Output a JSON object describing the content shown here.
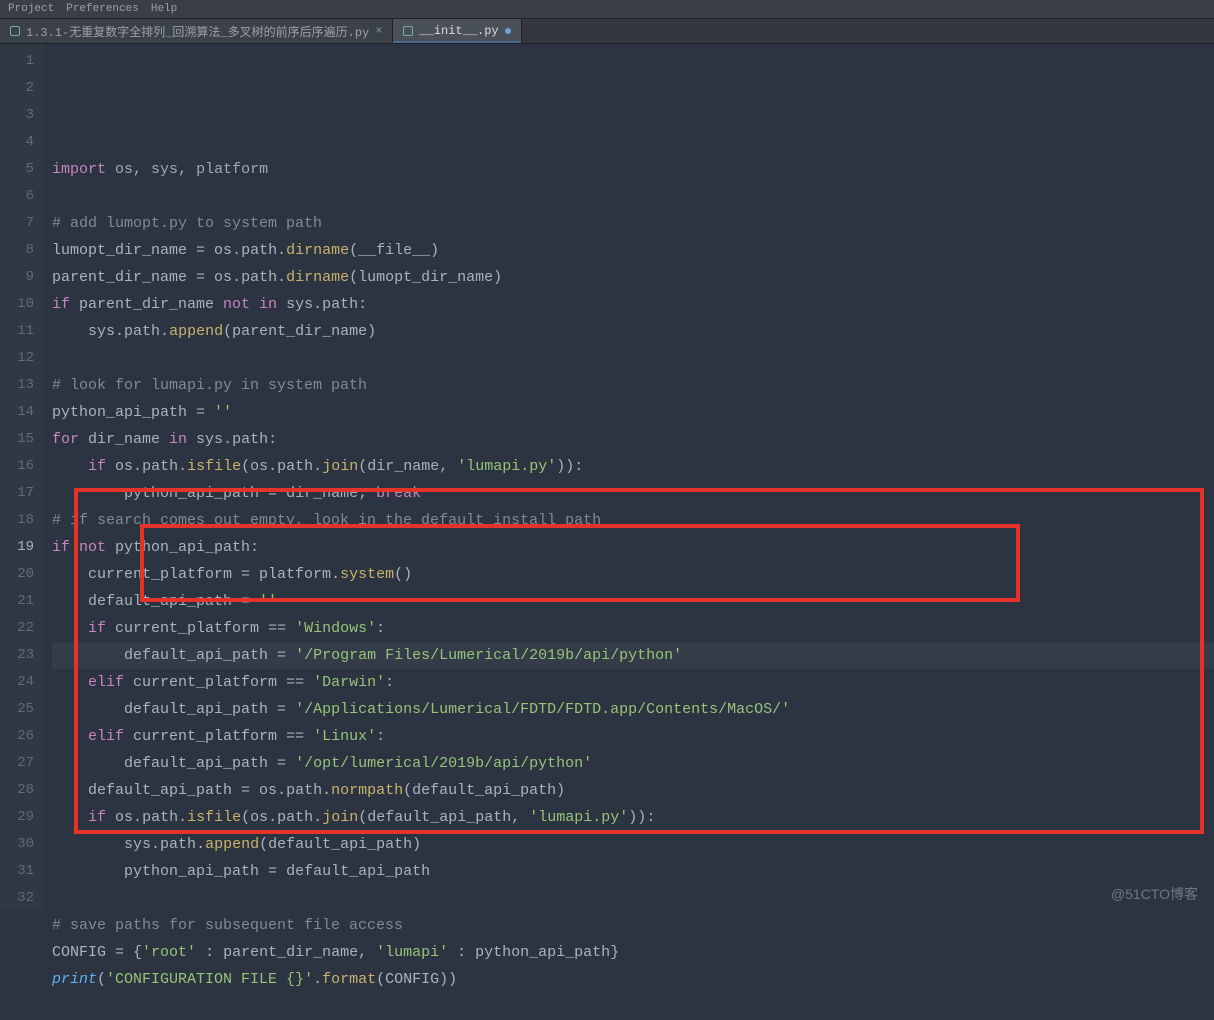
{
  "topbar": {
    "items": [
      "Project",
      "Preferences",
      "Help"
    ]
  },
  "tabs": [
    {
      "label": "1.3.1-无重复数字全排列_回溯算法_多叉树的前序后序遍历.py",
      "active": false,
      "dirty": false
    },
    {
      "label": "__init__.py",
      "active": true,
      "dirty": true
    }
  ],
  "current_line": 19,
  "lines": [
    {
      "n": 1,
      "tokens": [
        [
          "kw",
          "import"
        ],
        [
          "dn",
          " os"
        ],
        [
          "op",
          ","
        ],
        [
          "dn",
          " sys"
        ],
        [
          "op",
          ","
        ],
        [
          "dn",
          " platform"
        ]
      ]
    },
    {
      "n": 2,
      "tokens": []
    },
    {
      "n": 3,
      "tokens": [
        [
          "cmt",
          "# add lumopt.py to system path"
        ]
      ]
    },
    {
      "n": 4,
      "tokens": [
        [
          "id",
          "lumopt_dir_name "
        ],
        [
          "op",
          "="
        ],
        [
          "id",
          " os"
        ],
        [
          "op",
          "."
        ],
        [
          "id",
          "path"
        ],
        [
          "op",
          "."
        ],
        [
          "fn",
          "dirname"
        ],
        [
          "op",
          "("
        ],
        [
          "id",
          "__file__"
        ],
        [
          "op",
          ")"
        ]
      ]
    },
    {
      "n": 5,
      "tokens": [
        [
          "id",
          "parent_dir_name "
        ],
        [
          "op",
          "="
        ],
        [
          "id",
          " os"
        ],
        [
          "op",
          "."
        ],
        [
          "id",
          "path"
        ],
        [
          "op",
          "."
        ],
        [
          "fn",
          "dirname"
        ],
        [
          "op",
          "("
        ],
        [
          "id",
          "lumopt_dir_name"
        ],
        [
          "op",
          ")"
        ]
      ]
    },
    {
      "n": 6,
      "tokens": [
        [
          "kw",
          "if"
        ],
        [
          "id",
          " parent_dir_name "
        ],
        [
          "kw",
          "not in"
        ],
        [
          "id",
          " sys"
        ],
        [
          "op",
          "."
        ],
        [
          "id",
          "path"
        ],
        [
          "op",
          ":"
        ]
      ]
    },
    {
      "n": 7,
      "tokens": [
        [
          "id",
          "    sys"
        ],
        [
          "op",
          "."
        ],
        [
          "id",
          "path"
        ],
        [
          "op",
          "."
        ],
        [
          "fn",
          "append"
        ],
        [
          "op",
          "("
        ],
        [
          "id",
          "parent_dir_name"
        ],
        [
          "op",
          ")"
        ]
      ]
    },
    {
      "n": 8,
      "tokens": []
    },
    {
      "n": 9,
      "tokens": [
        [
          "cmt",
          "# look for lumapi.py in system path"
        ]
      ]
    },
    {
      "n": 10,
      "tokens": [
        [
          "id",
          "python_api_path "
        ],
        [
          "op",
          "="
        ],
        [
          "str",
          " ''"
        ]
      ]
    },
    {
      "n": 11,
      "tokens": [
        [
          "kw",
          "for"
        ],
        [
          "id",
          " dir_name "
        ],
        [
          "kw",
          "in"
        ],
        [
          "id",
          " sys"
        ],
        [
          "op",
          "."
        ],
        [
          "id",
          "path"
        ],
        [
          "op",
          ":"
        ]
      ]
    },
    {
      "n": 12,
      "tokens": [
        [
          "id",
          "    "
        ],
        [
          "kw",
          "if"
        ],
        [
          "id",
          " os"
        ],
        [
          "op",
          "."
        ],
        [
          "id",
          "path"
        ],
        [
          "op",
          "."
        ],
        [
          "fn",
          "isfile"
        ],
        [
          "op",
          "("
        ],
        [
          "id",
          "os"
        ],
        [
          "op",
          "."
        ],
        [
          "id",
          "path"
        ],
        [
          "op",
          "."
        ],
        [
          "fn",
          "join"
        ],
        [
          "op",
          "("
        ],
        [
          "id",
          "dir_name"
        ],
        [
          "op",
          ","
        ],
        [
          "str",
          " 'lumapi.py'"
        ],
        [
          "op",
          "))"
        ],
        [
          "op",
          ":"
        ]
      ]
    },
    {
      "n": 13,
      "tokens": [
        [
          "id",
          "        python_api_path "
        ],
        [
          "op",
          "="
        ],
        [
          "id",
          " dir_name"
        ],
        [
          "op",
          "; "
        ],
        [
          "kw",
          "break"
        ]
      ]
    },
    {
      "n": 14,
      "tokens": [
        [
          "cmt",
          "# if search comes out empty, look in the default install path"
        ]
      ]
    },
    {
      "n": 15,
      "tokens": [
        [
          "kw",
          "if not"
        ],
        [
          "id",
          " python_api_path"
        ],
        [
          "op",
          ":"
        ]
      ]
    },
    {
      "n": 16,
      "tokens": [
        [
          "id",
          "    current_platform "
        ],
        [
          "op",
          "="
        ],
        [
          "id",
          " platform"
        ],
        [
          "op",
          "."
        ],
        [
          "fn",
          "system"
        ],
        [
          "op",
          "()"
        ]
      ]
    },
    {
      "n": 17,
      "tokens": [
        [
          "id",
          "    default_api_path "
        ],
        [
          "op",
          "="
        ],
        [
          "str",
          " ''"
        ]
      ]
    },
    {
      "n": 18,
      "tokens": [
        [
          "id",
          "    "
        ],
        [
          "kw",
          "if"
        ],
        [
          "id",
          " current_platform "
        ],
        [
          "op",
          "=="
        ],
        [
          "str",
          " 'Windows'"
        ],
        [
          "op",
          ":"
        ]
      ]
    },
    {
      "n": 19,
      "tokens": [
        [
          "id",
          "        default_api_path "
        ],
        [
          "op",
          "="
        ],
        [
          "str",
          " '/Program Files/Lumerical/2019b/api/python'"
        ]
      ]
    },
    {
      "n": 20,
      "tokens": [
        [
          "id",
          "    "
        ],
        [
          "kw",
          "elif"
        ],
        [
          "id",
          " current_platform "
        ],
        [
          "op",
          "=="
        ],
        [
          "str",
          " 'Darwin'"
        ],
        [
          "op",
          ":"
        ]
      ]
    },
    {
      "n": 21,
      "tokens": [
        [
          "id",
          "        default_api_path "
        ],
        [
          "op",
          "="
        ],
        [
          "str",
          " '/Applications/Lumerical/FDTD/FDTD.app/Contents/MacOS/'"
        ]
      ]
    },
    {
      "n": 22,
      "tokens": [
        [
          "id",
          "    "
        ],
        [
          "kw",
          "elif"
        ],
        [
          "id",
          " current_platform "
        ],
        [
          "op",
          "=="
        ],
        [
          "str",
          " 'Linux'"
        ],
        [
          "op",
          ":"
        ]
      ]
    },
    {
      "n": 23,
      "tokens": [
        [
          "id",
          "        default_api_path "
        ],
        [
          "op",
          "="
        ],
        [
          "str",
          " '/opt/lumerical/2019b/api/python'"
        ]
      ]
    },
    {
      "n": 24,
      "tokens": [
        [
          "id",
          "    default_api_path "
        ],
        [
          "op",
          "="
        ],
        [
          "id",
          " os"
        ],
        [
          "op",
          "."
        ],
        [
          "id",
          "path"
        ],
        [
          "op",
          "."
        ],
        [
          "fn",
          "normpath"
        ],
        [
          "op",
          "("
        ],
        [
          "id",
          "default_api_path"
        ],
        [
          "op",
          ")"
        ]
      ]
    },
    {
      "n": 25,
      "tokens": [
        [
          "id",
          "    "
        ],
        [
          "kw",
          "if"
        ],
        [
          "id",
          " os"
        ],
        [
          "op",
          "."
        ],
        [
          "id",
          "path"
        ],
        [
          "op",
          "."
        ],
        [
          "fn",
          "isfile"
        ],
        [
          "op",
          "("
        ],
        [
          "id",
          "os"
        ],
        [
          "op",
          "."
        ],
        [
          "id",
          "path"
        ],
        [
          "op",
          "."
        ],
        [
          "fn",
          "join"
        ],
        [
          "op",
          "("
        ],
        [
          "id",
          "default_api_path"
        ],
        [
          "op",
          ","
        ],
        [
          "str",
          " 'lumapi.py'"
        ],
        [
          "op",
          "))"
        ],
        [
          "op",
          ":"
        ]
      ]
    },
    {
      "n": 26,
      "tokens": [
        [
          "id",
          "        sys"
        ],
        [
          "op",
          "."
        ],
        [
          "id",
          "path"
        ],
        [
          "op",
          "."
        ],
        [
          "fn",
          "append"
        ],
        [
          "op",
          "("
        ],
        [
          "id",
          "default_api_path"
        ],
        [
          "op",
          ")"
        ]
      ]
    },
    {
      "n": 27,
      "tokens": [
        [
          "id",
          "        python_api_path "
        ],
        [
          "op",
          "="
        ],
        [
          "id",
          " default_api_path"
        ]
      ]
    },
    {
      "n": 28,
      "tokens": []
    },
    {
      "n": 29,
      "tokens": [
        [
          "cmt",
          "# save paths for subsequent file access"
        ]
      ]
    },
    {
      "n": 30,
      "tokens": [
        [
          "id",
          "CONFIG "
        ],
        [
          "op",
          "="
        ],
        [
          "op",
          " {"
        ],
        [
          "str",
          "'root'"
        ],
        [
          "op",
          " : "
        ],
        [
          "id",
          "parent_dir_name"
        ],
        [
          "op",
          ", "
        ],
        [
          "str",
          "'lumapi'"
        ],
        [
          "op",
          " : "
        ],
        [
          "id",
          "python_api_path"
        ],
        [
          "op",
          "}"
        ]
      ]
    },
    {
      "n": 31,
      "tokens": [
        [
          "bi",
          "print"
        ],
        [
          "op",
          "("
        ],
        [
          "str",
          "'CONFIGURATION FILE {}'"
        ],
        [
          "op",
          "."
        ],
        [
          "fn",
          "format"
        ],
        [
          "op",
          "("
        ],
        [
          "id",
          "CONFIG"
        ],
        [
          "op",
          "))"
        ]
      ]
    },
    {
      "n": 32,
      "tokens": []
    }
  ],
  "watermark": "@51CTO博客"
}
